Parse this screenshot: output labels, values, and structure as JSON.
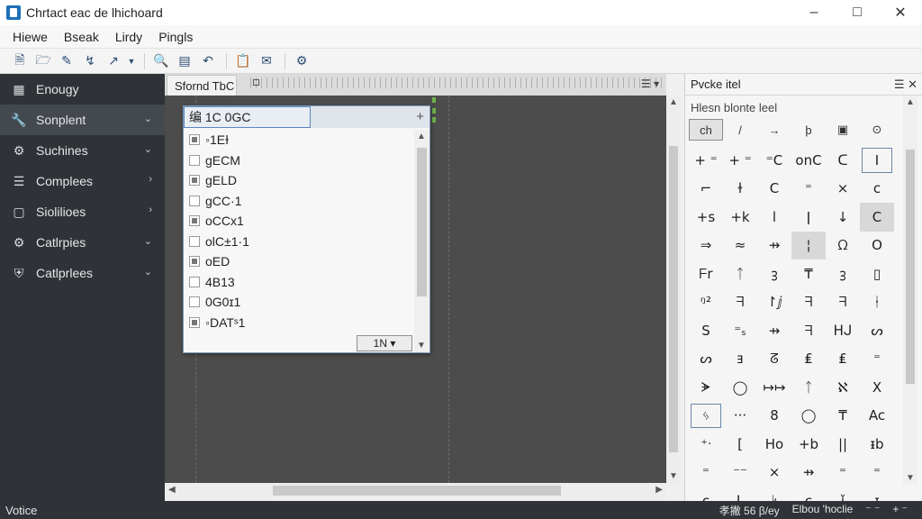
{
  "window": {
    "title": "Chrtact eac de lhichoard"
  },
  "menu": [
    "Hiewe",
    "Bseak",
    "Lirdy",
    "Pingls"
  ],
  "toolbar": [
    "new-file",
    "open-folder",
    "edit-pen",
    "link",
    "chart-line",
    "dropdown",
    "zoom",
    "bar-chart",
    "undo",
    "clipboard",
    "message",
    "tools"
  ],
  "sidebar": {
    "items": [
      {
        "label": "Enougy",
        "icon": "grid-icon",
        "chevron": ""
      },
      {
        "label": "Sonplent",
        "icon": "wrench-icon",
        "chevron": "⌄",
        "active": true
      },
      {
        "label": "Suchines",
        "icon": "gear-icon",
        "chevron": "⌄"
      },
      {
        "label": "Complees",
        "icon": "list-icon",
        "chevron": "›"
      },
      {
        "label": "Siolilioes",
        "icon": "monitor-icon",
        "chevron": "›"
      },
      {
        "label": "Catlrpies",
        "icon": "gear-icon",
        "chevron": "⌄"
      },
      {
        "label": "Catlprlees",
        "icon": "shield-icon",
        "chevron": "⌄"
      }
    ]
  },
  "center": {
    "tab_label": "Sfornd TbC",
    "menu_glyph": "☰ ▾",
    "list": {
      "header": "编 1C 0GC",
      "add_glyph": "+",
      "rows": [
        {
          "label": "◦1EƗ",
          "checked": true
        },
        {
          "label": "gECM",
          "checked": false
        },
        {
          "label": "gELD",
          "checked": true
        },
        {
          "label": "gCC·1",
          "checked": false
        },
        {
          "label": "oCCx1",
          "checked": true
        },
        {
          "label": "olC±1·1",
          "checked": false
        },
        {
          "label": "oED",
          "checked": true
        },
        {
          "label": "4B13",
          "checked": false
        },
        {
          "label": "0G0ɪ1",
          "checked": false
        },
        {
          "label": "◦DATˢ1",
          "checked": true
        }
      ],
      "combo": "1N ▾"
    }
  },
  "right_panel": {
    "title": "Pvcke itel",
    "header_controls": "☰ ✕",
    "subtitle": "Hlesn blonte leel",
    "tabs": [
      "ch",
      "/",
      "→",
      "þ",
      "▣",
      "⊙"
    ],
    "symbols": [
      "+ ⁼",
      "+ ⁼",
      "⁼C",
      "onC",
      "ᑕ",
      "Ⅰ",
      "⌐",
      "ɫ",
      "C",
      "⁼",
      "×",
      "c",
      "+s",
      "+k",
      "l",
      "ǀ",
      "↓",
      "C",
      "⇒",
      "≈",
      "⇸",
      "¦",
      "ᘯ",
      "O",
      "ᖴr",
      "ᛏ",
      "ᢃ",
      "₸",
      "ᢃ",
      "▯",
      "ᵑ²",
      "ᖷ",
      "↾ⅉ",
      "ᖷ",
      "ᖷ",
      "ᛂ",
      "S",
      "⁼ₛ",
      "⇸",
      "ᖷ",
      "ᕼᒍ",
      "ᔕ",
      "ᔕ",
      "ⱻ",
      "ᘔ",
      "₤",
      "₤",
      "⁼",
      "ᗚ",
      "◯",
      "↦↦",
      "ᛏ",
      "ℵ",
      "X",
      "ᛃ",
      "···",
      "8",
      "◯",
      "₸",
      "Ac",
      "⁺ᐧ",
      "[",
      "Ho",
      "+b",
      "||",
      "ᵻb",
      "⁼",
      "⁻⁻",
      "×",
      "⇸",
      "⁼",
      "⁼",
      "c",
      "ᒪ",
      "ᛋ",
      "c",
      "ǐ",
      "ᵻ"
    ],
    "selected_symbols": [
      17,
      21
    ],
    "outlined_symbols": [
      5,
      54
    ]
  },
  "status": {
    "left": "Votice",
    "right": [
      "孝撇 56 β/ey",
      "Elbou 'hoclie",
      "⁻ ⁻",
      "+ ⁻"
    ]
  }
}
